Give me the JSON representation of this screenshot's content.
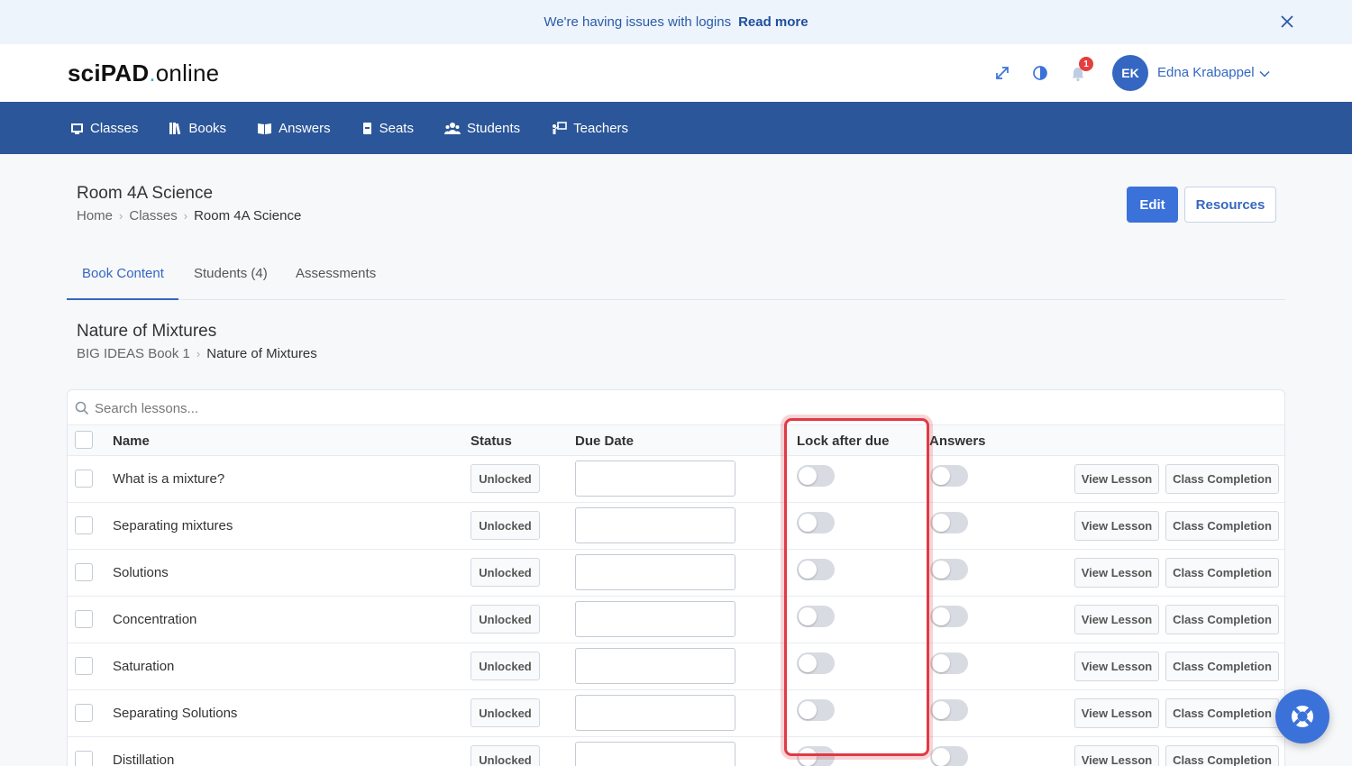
{
  "banner": {
    "message": "We're having issues with logins",
    "link": "Read more"
  },
  "header": {
    "logo_bold": "sciPAD",
    "logo_dot": ".",
    "logo_rest": "online",
    "notification_count": "1",
    "user_initials": "EK",
    "user_name": "Edna Krabappel"
  },
  "nav": {
    "items": [
      {
        "label": "Classes",
        "icon": "classes-icon"
      },
      {
        "label": "Books",
        "icon": "books-icon"
      },
      {
        "label": "Answers",
        "icon": "answers-icon"
      },
      {
        "label": "Seats",
        "icon": "seats-icon"
      },
      {
        "label": "Students",
        "icon": "students-icon"
      },
      {
        "label": "Teachers",
        "icon": "teachers-icon"
      }
    ]
  },
  "page": {
    "title": "Room 4A Science",
    "breadcrumb": [
      "Home",
      "Classes",
      "Room 4A Science"
    ],
    "edit_label": "Edit",
    "resources_label": "Resources"
  },
  "tabs": [
    {
      "label": "Book Content",
      "active": true
    },
    {
      "label": "Students (4)",
      "active": false
    },
    {
      "label": "Assessments",
      "active": false
    }
  ],
  "section": {
    "title": "Nature of Mixtures",
    "breadcrumb": [
      "BIG IDEAS Book 1",
      "Nature of Mixtures"
    ]
  },
  "table": {
    "search_placeholder": "Search lessons...",
    "headers": {
      "name": "Name",
      "status": "Status",
      "due_date": "Due Date",
      "lock_after_due": "Lock after due",
      "answers": "Answers"
    },
    "view_lesson_label": "View Lesson",
    "class_completion_label": "Class Completion",
    "rows": [
      {
        "name": "What is a mixture?",
        "status": "Unlocked",
        "due_date": "",
        "lock_after_due": false,
        "answers": false
      },
      {
        "name": "Separating mixtures",
        "status": "Unlocked",
        "due_date": "",
        "lock_after_due": false,
        "answers": false
      },
      {
        "name": "Solutions",
        "status": "Unlocked",
        "due_date": "",
        "lock_after_due": false,
        "answers": false
      },
      {
        "name": "Concentration",
        "status": "Unlocked",
        "due_date": "",
        "lock_after_due": false,
        "answers": false
      },
      {
        "name": "Saturation",
        "status": "Unlocked",
        "due_date": "",
        "lock_after_due": false,
        "answers": false
      },
      {
        "name": "Separating Solutions",
        "status": "Unlocked",
        "due_date": "",
        "lock_after_due": false,
        "answers": false
      },
      {
        "name": "Distillation",
        "status": "Unlocked",
        "due_date": "",
        "lock_after_due": false,
        "answers": false
      }
    ]
  },
  "colors": {
    "brand_blue": "#2b5699",
    "accent_blue": "#3b72d9",
    "highlight_red": "#e03a45",
    "banner_bg": "#eef4fc"
  }
}
